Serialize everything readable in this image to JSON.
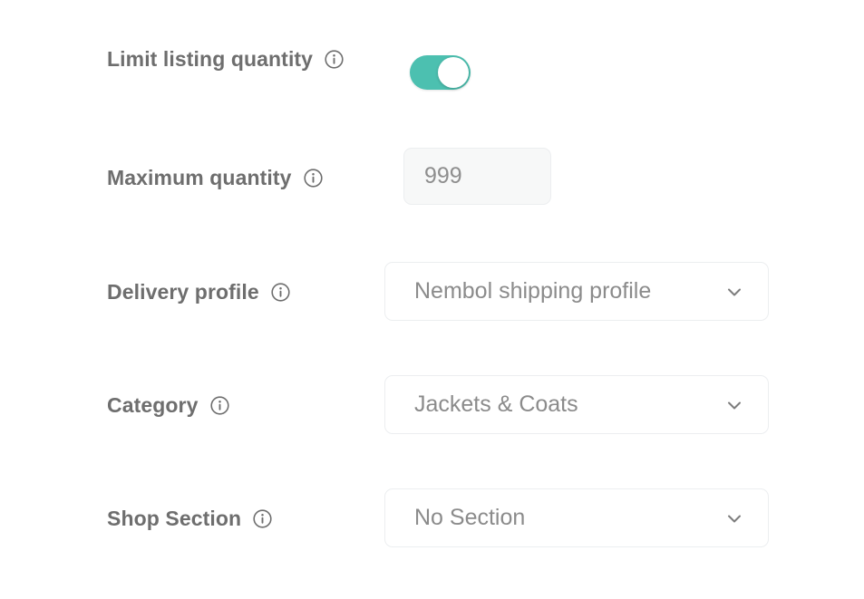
{
  "fields": {
    "limit_listing_quantity": {
      "label": "Limit listing quantity",
      "info_icon": "info-circle-icon",
      "toggle_state": "on"
    },
    "maximum_quantity": {
      "label": "Maximum quantity",
      "info_icon": "info-circle-icon",
      "value": "999"
    },
    "delivery_profile": {
      "label": "Delivery profile",
      "info_icon": "info-circle-icon",
      "value": "Nembol shipping profile",
      "chevron_icon": "chevron-down-icon"
    },
    "category": {
      "label": "Category",
      "info_icon": "info-circle-icon",
      "value": "Jackets & Coats",
      "chevron_icon": "chevron-down-icon"
    },
    "shop_section": {
      "label": "Shop Section",
      "info_icon": "info-circle-icon",
      "value": "No Section",
      "chevron_icon": "chevron-down-icon"
    }
  },
  "colors": {
    "toggle_on": "#4cc0b0",
    "label_text": "#6e6e6e",
    "value_text": "#8b8b8b",
    "border": "#eceef0",
    "input_fill": "#f7f8f8",
    "background": "#ffffff"
  }
}
